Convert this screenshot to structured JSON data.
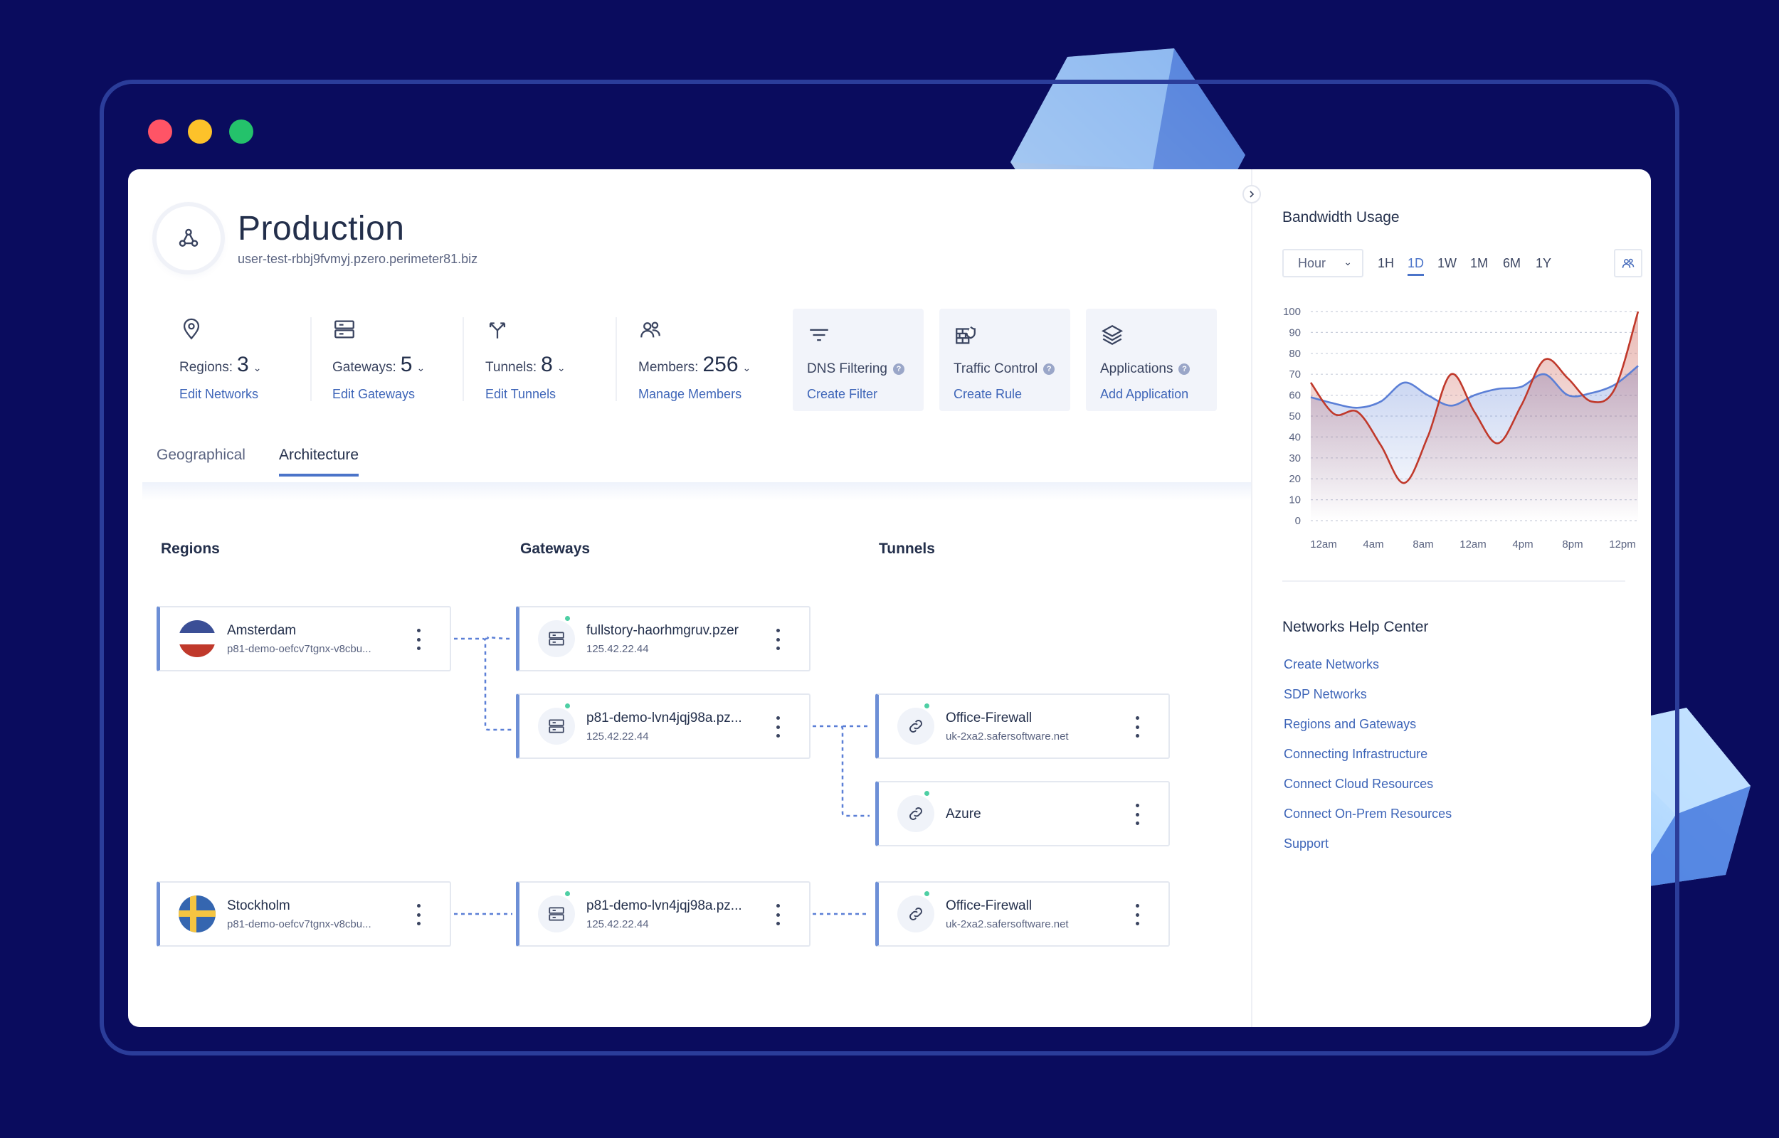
{
  "page": {
    "title": "Production",
    "subtitle": "user-test-rbbj9fvmyj.pzero.perimeter81.biz"
  },
  "stats": [
    {
      "icon": "location-pin-icon",
      "label": "Regions:",
      "value": "3",
      "link": "Edit Networks"
    },
    {
      "icon": "server-icon",
      "label": "Gateways:",
      "value": "5",
      "link": "Edit Gateways"
    },
    {
      "icon": "fork-icon",
      "label": "Tunnels:",
      "value": "8",
      "link": "Edit Tunnels"
    },
    {
      "icon": "users-icon",
      "label": "Members:",
      "value": "256",
      "link": "Manage Members"
    }
  ],
  "actions": [
    {
      "icon": "filter-icon",
      "title": "DNS Filtering",
      "link": "Create Filter"
    },
    {
      "icon": "firewall-icon",
      "title": "Traffic Control",
      "link": "Create Rule"
    },
    {
      "icon": "layers-icon",
      "title": "Applications",
      "link": "Add Application"
    }
  ],
  "tabs": [
    {
      "label": "Geographical",
      "active": false
    },
    {
      "label": "Architecture",
      "active": true
    }
  ],
  "columns": {
    "regions": "Regions",
    "gateways": "Gateways",
    "tunnels": "Tunnels"
  },
  "regions": [
    {
      "name": "Amsterdam",
      "sub": "p81-demo-oefcv7tgnx-v8cbu...",
      "flag": "netherlands-flag-icon"
    },
    {
      "name": "Stockholm",
      "sub": "p81-demo-oefcv7tgnx-v8cbu...",
      "flag": "sweden-flag-icon"
    }
  ],
  "gateways": [
    {
      "name": "fullstory-haorhmgruv.pzer",
      "sub": "125.42.22.44",
      "status": "online"
    },
    {
      "name": "p81-demo-lvn4jqj98a.pz...",
      "sub": "125.42.22.44",
      "status": "online"
    },
    {
      "name": "p81-demo-lvn4jqj98a.pz...",
      "sub": "125.42.22.44",
      "status": "online"
    }
  ],
  "tunnels": [
    {
      "name": "Office-Firewall",
      "sub": "uk-2xa2.safersoftware.net",
      "status": "online"
    },
    {
      "name": "Azure",
      "sub": "",
      "status": "online"
    },
    {
      "name": "Office-Firewall",
      "sub": "uk-2xa2.safersoftware.net",
      "status": "online"
    }
  ],
  "sidebar": {
    "bandwidth_title": "Bandwidth Usage",
    "granularity": "Hour",
    "ranges": [
      "1H",
      "1D",
      "1W",
      "1M",
      "6M",
      "1Y"
    ],
    "active_range": "1D",
    "help_title": "Networks Help Center",
    "help_links": [
      "Create Networks",
      "SDP Networks",
      "Regions and Gateways",
      "Connecting Infrastructure",
      "Connect Cloud Resources",
      "Connect On-Prem Resources",
      "Support"
    ]
  },
  "chart_data": {
    "type": "area",
    "ylim": [
      0,
      100
    ],
    "yticks": [
      "100",
      "90",
      "80",
      "70",
      "60",
      "50",
      "40",
      "30",
      "20",
      "10",
      "0"
    ],
    "xticks": [
      "12am",
      "4am",
      "8am",
      "12am",
      "4pm",
      "8pm",
      "12pm"
    ],
    "x": [
      0,
      4,
      8,
      12,
      16,
      20,
      24,
      28,
      32,
      36,
      40,
      44,
      48,
      52,
      56
    ],
    "series": [
      {
        "color": "#5b7fd6",
        "values": [
          59,
          56,
          54,
          57,
          66,
          60,
          55,
          60,
          63,
          64,
          70,
          60,
          61,
          65,
          74
        ]
      },
      {
        "color": "#c0392b",
        "values": [
          66,
          51,
          52,
          36,
          18,
          40,
          70,
          52,
          37,
          55,
          77,
          68,
          57,
          63,
          100
        ]
      }
    ]
  },
  "colors": {
    "accent": "#4b74c9",
    "link": "#3e65b8",
    "background": "#0a0c5e",
    "status_online": "#4ecfa4"
  }
}
